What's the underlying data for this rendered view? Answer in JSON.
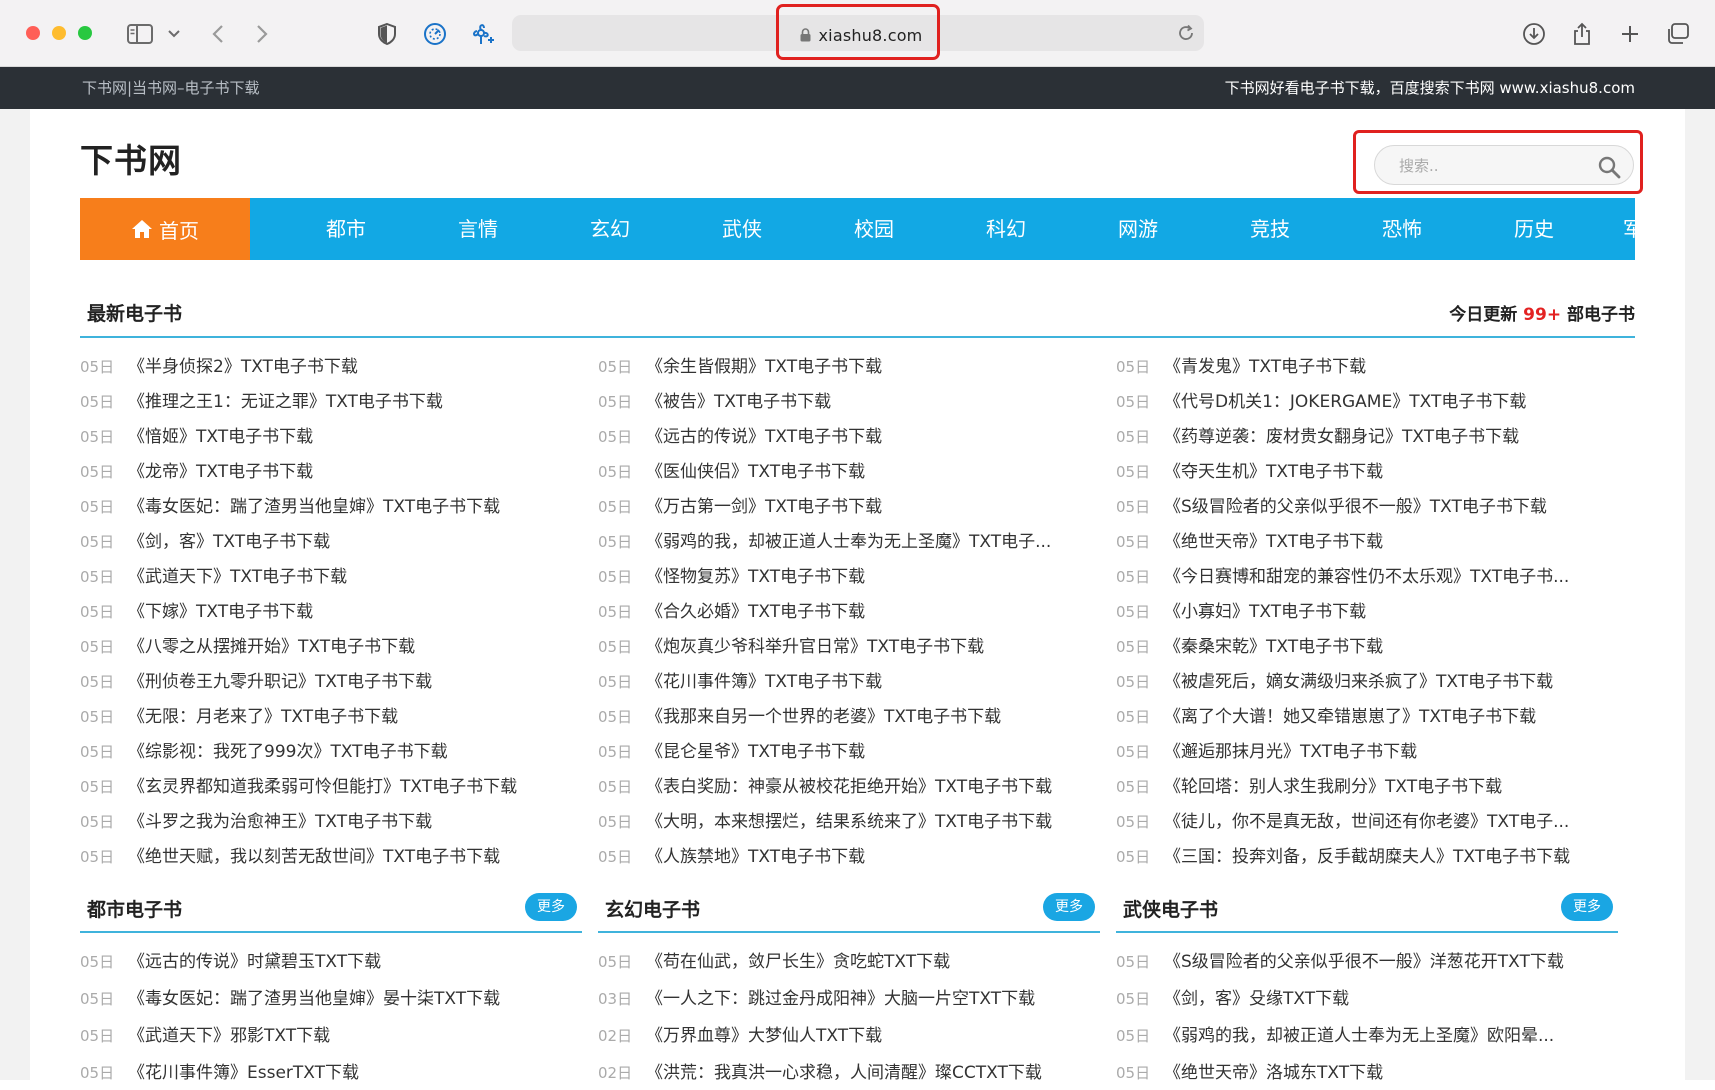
{
  "browser": {
    "url": "xiashu8.com",
    "colors": {
      "close": "#ff5f57",
      "minimize": "#febc2e",
      "zoom": "#28c840"
    }
  },
  "site_bar": {
    "left": "下书网|当书网–电子书下载",
    "right": "下书网好看电子书下载，百度搜索下书网 www.xiashu8.com"
  },
  "header": {
    "logo": "下书网",
    "search_placeholder": "搜索.."
  },
  "nav": {
    "home": "首页",
    "items": [
      "都市",
      "言情",
      "玄幻",
      "武侠",
      "校园",
      "科幻",
      "网游",
      "竞技",
      "恐怖",
      "历史",
      "军"
    ]
  },
  "latest": {
    "title": "最新电子书",
    "today_prefix": "今日更新",
    "today_count": "99+",
    "today_suffix": "部电子书",
    "columns": [
      [
        {
          "date": "05日",
          "title": "《半身侦探2》TXT电子书下载"
        },
        {
          "date": "05日",
          "title": "《推理之王1：无证之罪》TXT电子书下载"
        },
        {
          "date": "05日",
          "title": "《愔姬》TXT电子书下载"
        },
        {
          "date": "05日",
          "title": "《龙帝》TXT电子书下载"
        },
        {
          "date": "05日",
          "title": "《毒女医妃：踹了渣男当他皇婶》TXT电子书下载"
        },
        {
          "date": "05日",
          "title": "《剑，客》TXT电子书下载"
        },
        {
          "date": "05日",
          "title": "《武道天下》TXT电子书下载"
        },
        {
          "date": "05日",
          "title": "《下嫁》TXT电子书下载"
        },
        {
          "date": "05日",
          "title": "《八零之从摆摊开始》TXT电子书下载"
        },
        {
          "date": "05日",
          "title": "《刑侦卷王九零升职记》TXT电子书下载"
        },
        {
          "date": "05日",
          "title": "《无限：月老来了》TXT电子书下载"
        },
        {
          "date": "05日",
          "title": "《综影视：我死了999次》TXT电子书下载"
        },
        {
          "date": "05日",
          "title": "《玄灵界都知道我柔弱可怜但能打》TXT电子书下载"
        },
        {
          "date": "05日",
          "title": "《斗罗之我为治愈神王》TXT电子书下载"
        },
        {
          "date": "05日",
          "title": "《绝世天赋，我以刻苦无敌世间》TXT电子书下载"
        }
      ],
      [
        {
          "date": "05日",
          "title": "《余生皆假期》TXT电子书下载"
        },
        {
          "date": "05日",
          "title": "《被告》TXT电子书下载"
        },
        {
          "date": "05日",
          "title": "《远古的传说》TXT电子书下载"
        },
        {
          "date": "05日",
          "title": "《医仙侠侣》TXT电子书下载"
        },
        {
          "date": "05日",
          "title": "《万古第一剑》TXT电子书下载"
        },
        {
          "date": "05日",
          "title": "《弱鸡的我，却被正道人士奉为无上圣魔》TXT电子..."
        },
        {
          "date": "05日",
          "title": "《怪物复苏》TXT电子书下载"
        },
        {
          "date": "05日",
          "title": "《合久必婚》TXT电子书下载"
        },
        {
          "date": "05日",
          "title": "《炮灰真少爷科举升官日常》TXT电子书下载"
        },
        {
          "date": "05日",
          "title": "《花川事件簿》TXT电子书下载"
        },
        {
          "date": "05日",
          "title": "《我那来自另一个世界的老婆》TXT电子书下载"
        },
        {
          "date": "05日",
          "title": "《昆仑星爷》TXT电子书下载"
        },
        {
          "date": "05日",
          "title": "《表白奖励：神豪从被校花拒绝开始》TXT电子书下载"
        },
        {
          "date": "05日",
          "title": "《大明，本来想摆烂，结果系统来了》TXT电子书下载"
        },
        {
          "date": "05日",
          "title": "《人族禁地》TXT电子书下载"
        }
      ],
      [
        {
          "date": "05日",
          "title": "《青发鬼》TXT电子书下载"
        },
        {
          "date": "05日",
          "title": "《代号D机关1：JOKERGAME》TXT电子书下载"
        },
        {
          "date": "05日",
          "title": "《药尊逆袭：废材贵女翻身记》TXT电子书下载"
        },
        {
          "date": "05日",
          "title": "《夺天生机》TXT电子书下载"
        },
        {
          "date": "05日",
          "title": "《S级冒险者的父亲似乎很不一般》TXT电子书下载"
        },
        {
          "date": "05日",
          "title": "《绝世天帝》TXT电子书下载"
        },
        {
          "date": "05日",
          "title": "《今日赛博和甜宠的兼容性仍不太乐观》TXT电子书..."
        },
        {
          "date": "05日",
          "title": "《小寡妇》TXT电子书下载"
        },
        {
          "date": "05日",
          "title": "《秦桑宋乾》TXT电子书下载"
        },
        {
          "date": "05日",
          "title": "《被虐死后，嫡女满级归来杀疯了》TXT电子书下载"
        },
        {
          "date": "05日",
          "title": "《离了个大谱！她又牵错崽崽了》TXT电子书下载"
        },
        {
          "date": "05日",
          "title": "《邂逅那抹月光》TXT电子书下载"
        },
        {
          "date": "05日",
          "title": "《轮回塔：别人求生我刷分》TXT电子书下载"
        },
        {
          "date": "05日",
          "title": "《徒儿，你不是真无敌，世间还有你老婆》TXT电子..."
        },
        {
          "date": "05日",
          "title": "《三国：投奔刘备，反手截胡糜夫人》TXT电子书下载"
        }
      ]
    ]
  },
  "categories": [
    {
      "title": "都市电子书",
      "more": "更多",
      "items": [
        {
          "date": "05日",
          "title": "《远古的传说》时黛碧玉TXT下载"
        },
        {
          "date": "05日",
          "title": "《毒女医妃：踹了渣男当他皇婶》晏十柒TXT下载"
        },
        {
          "date": "05日",
          "title": "《武道天下》邪影TXT下载"
        },
        {
          "date": "05日",
          "title": "《花川事件簿》EsserTXT下载"
        }
      ]
    },
    {
      "title": "玄幻电子书",
      "more": "更多",
      "items": [
        {
          "date": "05日",
          "title": "《苟在仙武，敛尸长生》贪吃蛇TXT下载"
        },
        {
          "date": "03日",
          "title": "《一人之下：跳过金丹成阳神》大脑一片空TXT下载"
        },
        {
          "date": "02日",
          "title": "《万界血尊》大梦仙人TXT下载"
        },
        {
          "date": "02日",
          "title": "《洪荒：我真洪一心求稳，人间清醒》璨CCTXT下载"
        }
      ]
    },
    {
      "title": "武侠电子书",
      "more": "更多",
      "items": [
        {
          "date": "05日",
          "title": "《S级冒险者的父亲似乎很不一般》洋葱花开TXT下载"
        },
        {
          "date": "05日",
          "title": "《剑，客》殳缘TXT下载"
        },
        {
          "date": "05日",
          "title": "《弱鸡的我，却被正道人士奉为无上圣魔》欧阳晕..."
        },
        {
          "date": "05日",
          "title": "《绝世天帝》洛城东TXT下载"
        }
      ]
    }
  ]
}
